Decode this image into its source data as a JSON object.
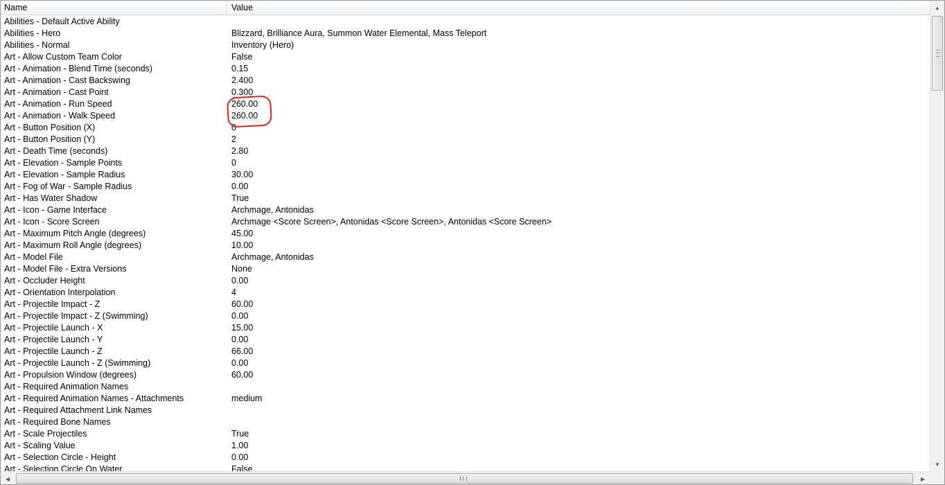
{
  "columns": {
    "name": "Name",
    "value": "Value"
  },
  "rows": [
    {
      "name": "Abilities - Default Active Ability",
      "value": ""
    },
    {
      "name": "Abilities - Hero",
      "value": "Blizzard, Brilliance Aura, Summon Water Elemental, Mass Teleport"
    },
    {
      "name": "Abilities - Normal",
      "value": "Inventory (Hero)"
    },
    {
      "name": "Art - Allow Custom Team Color",
      "value": "False"
    },
    {
      "name": "Art - Animation - Blend Time (seconds)",
      "value": "0.15"
    },
    {
      "name": "Art - Animation - Cast Backswing",
      "value": "2.400"
    },
    {
      "name": "Art - Animation - Cast Point",
      "value": "0.300"
    },
    {
      "name": "Art - Animation - Run Speed",
      "value": "260.00"
    },
    {
      "name": "Art - Animation - Walk Speed",
      "value": "260.00"
    },
    {
      "name": "Art - Button Position (X)",
      "value": "0"
    },
    {
      "name": "Art - Button Position (Y)",
      "value": "2"
    },
    {
      "name": "Art - Death Time (seconds)",
      "value": "2.80"
    },
    {
      "name": "Art - Elevation - Sample Points",
      "value": "0"
    },
    {
      "name": "Art - Elevation - Sample Radius",
      "value": "30.00"
    },
    {
      "name": "Art - Fog of War - Sample Radius",
      "value": "0.00"
    },
    {
      "name": "Art - Has Water Shadow",
      "value": "True"
    },
    {
      "name": "Art - Icon - Game Interface",
      "value": "Archmage, Antonidas"
    },
    {
      "name": "Art - Icon - Score Screen",
      "value": "Archmage <Score Screen>, Antonidas <Score Screen>, Antonidas <Score Screen>"
    },
    {
      "name": "Art - Maximum Pitch Angle (degrees)",
      "value": "45.00"
    },
    {
      "name": "Art - Maximum Roll Angle (degrees)",
      "value": "10.00"
    },
    {
      "name": "Art - Model File",
      "value": "Archmage, Antonidas"
    },
    {
      "name": "Art - Model File - Extra Versions",
      "value": "None"
    },
    {
      "name": "Art - Occluder Height",
      "value": "0.00"
    },
    {
      "name": "Art - Orientation Interpolation",
      "value": "4"
    },
    {
      "name": "Art - Projectile Impact - Z",
      "value": "60.00"
    },
    {
      "name": "Art - Projectile Impact - Z (Swimming)",
      "value": "0.00"
    },
    {
      "name": "Art - Projectile Launch - X",
      "value": "15.00"
    },
    {
      "name": "Art - Projectile Launch - Y",
      "value": "0.00"
    },
    {
      "name": "Art - Projectile Launch - Z",
      "value": "66.00"
    },
    {
      "name": "Art - Projectile Launch - Z (Swimming)",
      "value": "0.00"
    },
    {
      "name": "Art - Propulsion Window (degrees)",
      "value": "60.00"
    },
    {
      "name": "Art - Required Animation Names",
      "value": ""
    },
    {
      "name": "Art - Required Animation Names - Attachments",
      "value": "medium"
    },
    {
      "name": "Art - Required Attachment Link Names",
      "value": ""
    },
    {
      "name": "Art - Required Bone Names",
      "value": ""
    },
    {
      "name": "Art - Scale Projectiles",
      "value": "True"
    },
    {
      "name": "Art - Scaling Value",
      "value": "1.00"
    },
    {
      "name": "Art - Selection Circle - Height",
      "value": "0.00"
    },
    {
      "name": "Art - Selection Circle On Water",
      "value": "False"
    }
  ],
  "annotation_color": "#e0201c",
  "icons": {
    "scroll_up": "scroll-up-arrow-icon",
    "scroll_down": "scroll-down-arrow-icon",
    "scroll_left": "scroll-left-arrow-icon",
    "scroll_right": "scroll-right-arrow-icon"
  }
}
